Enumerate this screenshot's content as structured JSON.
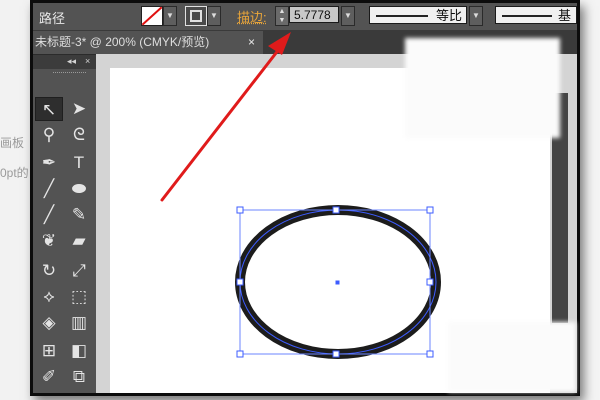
{
  "background": {
    "left_label_1": "画板",
    "left_label_2": "0pt的"
  },
  "control_bar": {
    "tool_name": "路径",
    "fill_swatch": "red-slash-none-fill",
    "stroke_swatch": "stroke-square-icon",
    "stroke_label": "描边:",
    "stroke_weight": "5.7778",
    "profile_label": "等比",
    "brush_label": "基"
  },
  "document_tab": {
    "title": "未标题-3* @ 200% (CMYK/预览)",
    "close": "×"
  },
  "tools_panel": {
    "collapse": "◂◂",
    "close": "×"
  },
  "colors": {
    "stroke_highlight": "#e8a53a",
    "ellipse_stroke": "#1c1c1c",
    "selection": "#3d5cff",
    "annotation_arrow": "#e01b1b"
  }
}
